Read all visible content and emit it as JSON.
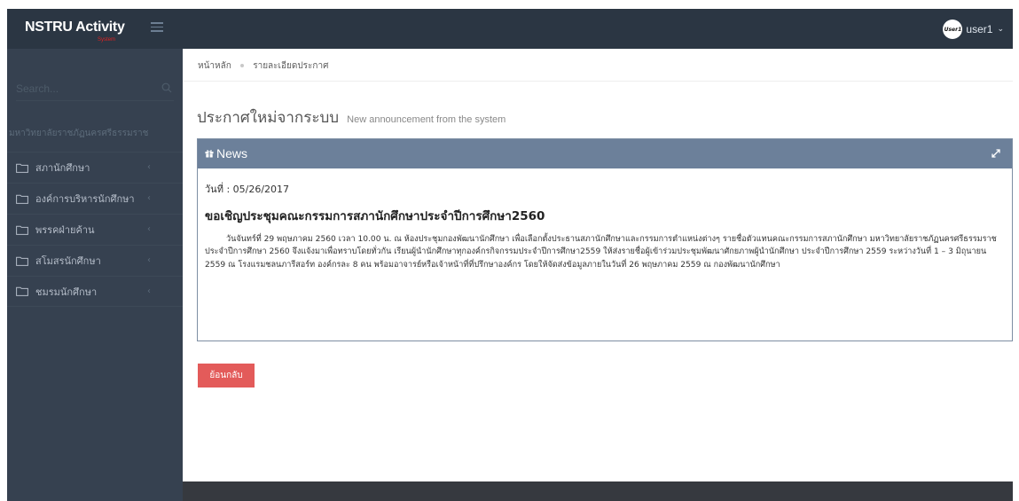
{
  "app": {
    "logo": "NSTRU Activity",
    "logo_sub": "System"
  },
  "header": {
    "avatar_text": "User1",
    "user_name": "user1"
  },
  "sidebar": {
    "search_placeholder": "Search...",
    "section_title": "มหาวิทยาลัยราชภัฏนครศรีธรรมราช",
    "items": [
      {
        "label": "สภานักศึกษา"
      },
      {
        "label": "องค์การบริหารนักศึกษา"
      },
      {
        "label": "พรรคฝ่ายค้าน"
      },
      {
        "label": "สโมสรนักศึกษา"
      },
      {
        "label": "ชมรมนักศึกษา"
      }
    ]
  },
  "breadcrumb": {
    "home": "หน้าหลัก",
    "current": "รายละเอียดประกาศ"
  },
  "page": {
    "title": "ประกาศใหม่จากระบบ",
    "subtitle": "New announcement from the system"
  },
  "portlet": {
    "title": "News",
    "date": "วันที่ : 05/26/2017",
    "headline": "ขอเชิญประชุมคณะกรรมการสภานักศึกษาประจำปีการศึกษา2560",
    "body": "วันจันทร์ที่ 29 พฤษภาคม 2560 เวลา 10.00 น. ณ ห้องประชุมกองพัฒนานักศึกษา เพื่อเลือกตั้งประธานสภานักศึกษาและกรรมการตำแหน่งต่างๆ รายชื่อตัวแทนคณะกรรมการสภานักศึกษา มหาวิทยาลัยราชภัฏนครศรีธรรมราช ประจำปีการศึกษา 2560 จึงแจ้งมาเพื่อทราบโดยทั่วกัน เรียนผู้นำนักศึกษาทุกองค์กรกิจกรรมประจำปีการศึกษา2559 ให้ส่งรายชื่อผู้เข้าร่วมประชุมพัฒนาศักยภาพผู้นำนักศึกษา ประจำปีการศึกษา 2559 ระหว่างวันที่ 1 – 3 มิถุนายน 2559 ณ โรงแรมชลนภารีสอร์ท องค์กรละ 8 คน พร้อมอาจารย์หรือเจ้าหน้าที่ที่ปรึกษาองค์กร โดยให้จัดส่งข้อมูลภายในวันที่ 26 พฤษภาคม 2559 ณ กองพัฒนานักศึกษา"
  },
  "actions": {
    "back_label": "ย้อนกลับ"
  },
  "colors": {
    "topbar": "#2b3643",
    "sidebar": "#364150",
    "portlet_header": "#6c809a",
    "back_button": "#e35b5a"
  }
}
